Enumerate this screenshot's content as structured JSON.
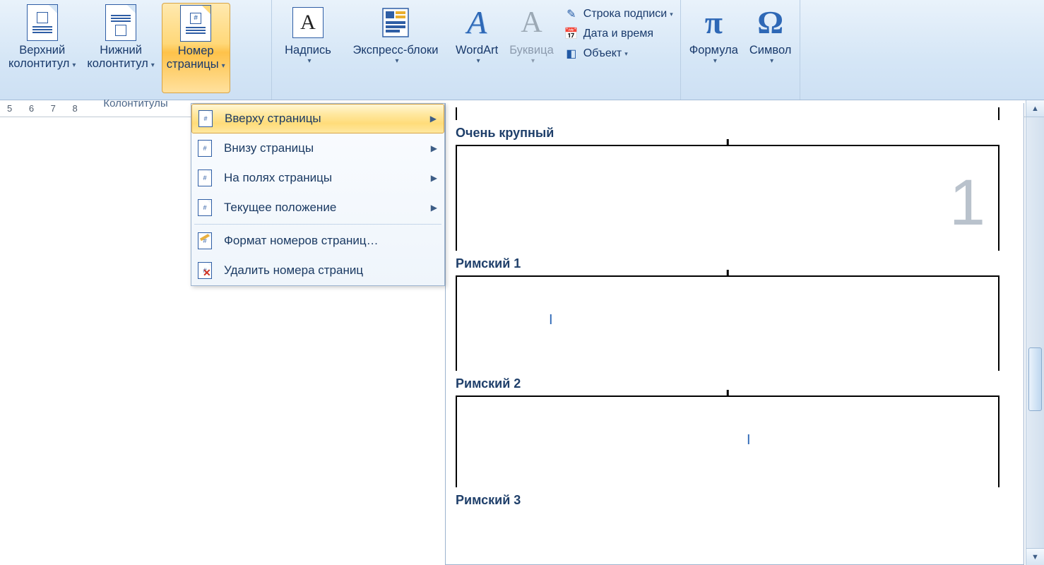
{
  "ribbon": {
    "groups": {
      "headers": {
        "title": "Колонтитулы",
        "top_header": {
          "line1": "Верхний",
          "line2": "колонтитул"
        },
        "bottom_header": {
          "line1": "Нижний",
          "line2": "колонтитул"
        },
        "page_number": {
          "line1": "Номер",
          "line2": "страницы"
        }
      },
      "text": {
        "textbox": "Надпись",
        "quick_parts": "Экспресс-блоки",
        "wordart": "WordArt",
        "dropcap": "Буквица",
        "signature": "Строка подписи",
        "datetime": "Дата и время",
        "object": "Объект"
      },
      "symbols": {
        "equation": "Формула",
        "symbol": "Символ"
      }
    }
  },
  "ruler": {
    "digits": "5  6  7  8"
  },
  "dropdown": {
    "items": [
      "Вверху страницы",
      "Внизу страницы",
      "На полях страницы",
      "Текущее положение",
      "Формат номеров страниц…",
      "Удалить номера страниц"
    ]
  },
  "gallery": {
    "cat1": "Очень крупный",
    "sample1_value": "1",
    "cat2": "Римский 1",
    "sample2_value": "I",
    "cat3": "Римский 2",
    "sample3_value": "I",
    "cat4": "Римский 3"
  }
}
